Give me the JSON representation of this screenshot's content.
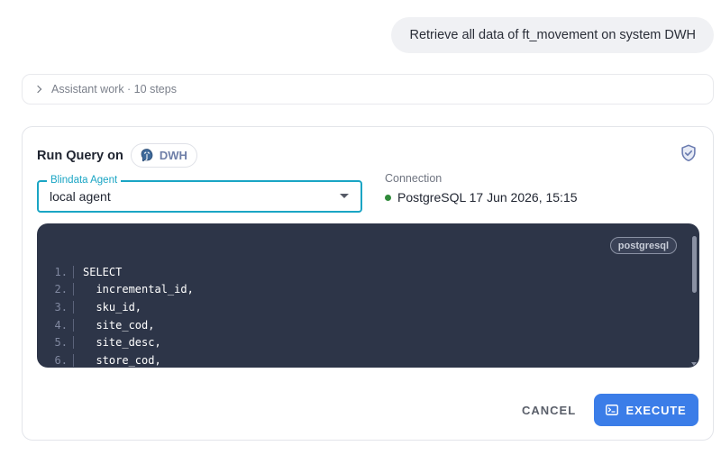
{
  "user_message": "Retrieve all data of ft_movement on system DWH",
  "assistant_work": {
    "label": "Assistant work · 10 steps"
  },
  "query_card": {
    "title": "Run Query on",
    "system_chip": "DWH",
    "agent": {
      "legend": "Blindata Agent",
      "value": "local agent"
    },
    "connection": {
      "label": "Connection",
      "value": "PostgreSQL 17 Jun 2026, 15:15",
      "status_color": "#2f8a3a"
    },
    "code": {
      "language": "postgresql",
      "lines": [
        {
          "n": "1.",
          "text": "SELECT"
        },
        {
          "n": "2.",
          "text": "  incremental_id,"
        },
        {
          "n": "3.",
          "text": "  sku_id,"
        },
        {
          "n": "4.",
          "text": "  site_cod,"
        },
        {
          "n": "5.",
          "text": "  site_desc,"
        },
        {
          "n": "6.",
          "text": "  store_cod,"
        }
      ]
    },
    "cancel_label": "CANCEL",
    "execute_label": "EXECUTE",
    "accent_color": "#1aa5c4",
    "execute_color": "#3b7de8"
  }
}
